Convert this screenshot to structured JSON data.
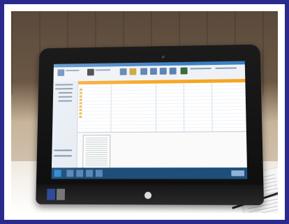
{
  "image": {
    "type": "photograph",
    "colors": {
      "outer_border": "#2a2a8c",
      "monitor": "#111111",
      "screen_bg": "#f4f6f8",
      "ribbon_accent": "#3b7fc4",
      "tab_accent": "#f6a623",
      "taskbar": "#1f4e79"
    }
  }
}
